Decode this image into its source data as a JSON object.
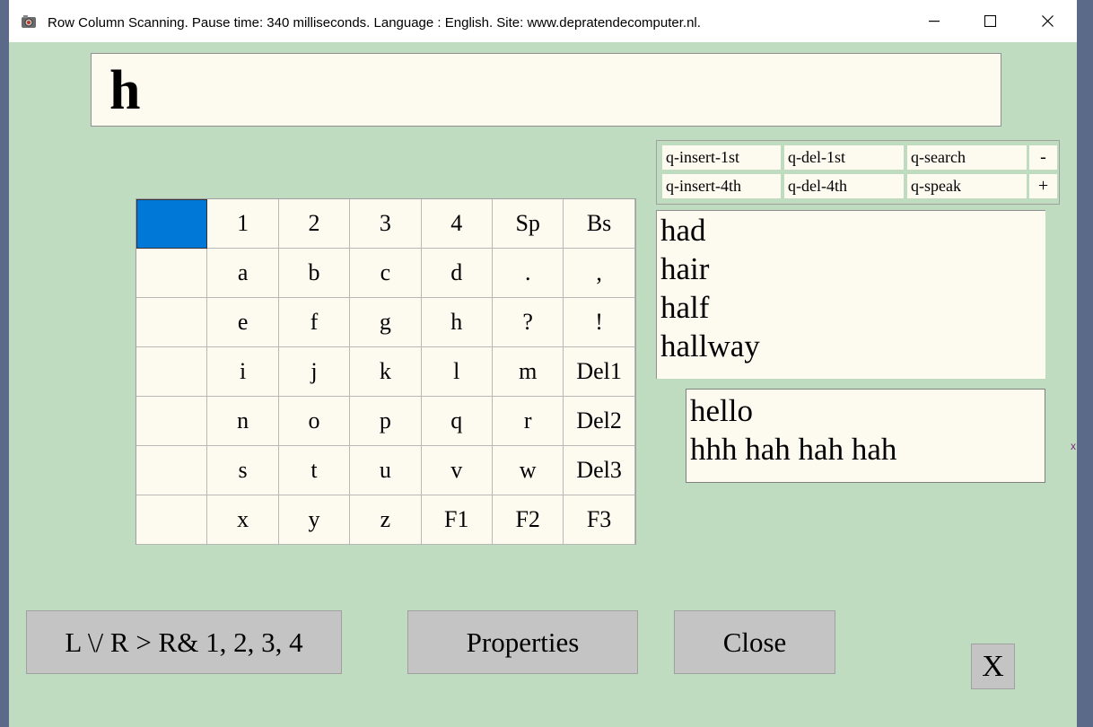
{
  "window": {
    "title": "Row Column Scanning.  Pause time: 340  milliseconds.   Language : English.  Site: www.depratendecomputer.nl.",
    "controls": {
      "minimize": "—",
      "maximize": "☐",
      "close": "✕"
    }
  },
  "output": {
    "text": "h"
  },
  "quick_actions": {
    "row1": [
      "q-insert-1st",
      "q-del-1st",
      "q-search"
    ],
    "row2": [
      "q-insert-4th",
      "q-del-4th",
      "q-speak"
    ],
    "minus": "-",
    "plus": "+"
  },
  "keyboard": {
    "rows": [
      [
        "",
        "1",
        "2",
        "3",
        "4",
        "Sp",
        "Bs"
      ],
      [
        "",
        "a",
        "b",
        "c",
        "d",
        ".",
        ","
      ],
      [
        "",
        "e",
        "f",
        "g",
        "h",
        "?",
        "!"
      ],
      [
        "",
        "i",
        "j",
        "k",
        "l",
        "m",
        "Del1"
      ],
      [
        "",
        "n",
        "o",
        "p",
        "q",
        "r",
        "Del2"
      ],
      [
        "",
        "s",
        "t",
        "u",
        "v",
        "w",
        "Del3"
      ],
      [
        "",
        "x",
        "y",
        "z",
        "F1",
        "F2",
        "F3"
      ]
    ],
    "highlight_color": "#0078d7"
  },
  "predictions": [
    "had",
    "hair",
    "half",
    "hallway"
  ],
  "phrases": [
    "hello",
    "hhh hah hah hah"
  ],
  "buttons": {
    "mode": "L \\/ R > R& 1, 2, 3, 4",
    "properties": "Properties",
    "close": "Close",
    "x": "X"
  },
  "colors": {
    "background": "#c0dcc0",
    "panel": "#fdfaf0",
    "button": "#c4c4c4"
  },
  "edge_mark": "x"
}
